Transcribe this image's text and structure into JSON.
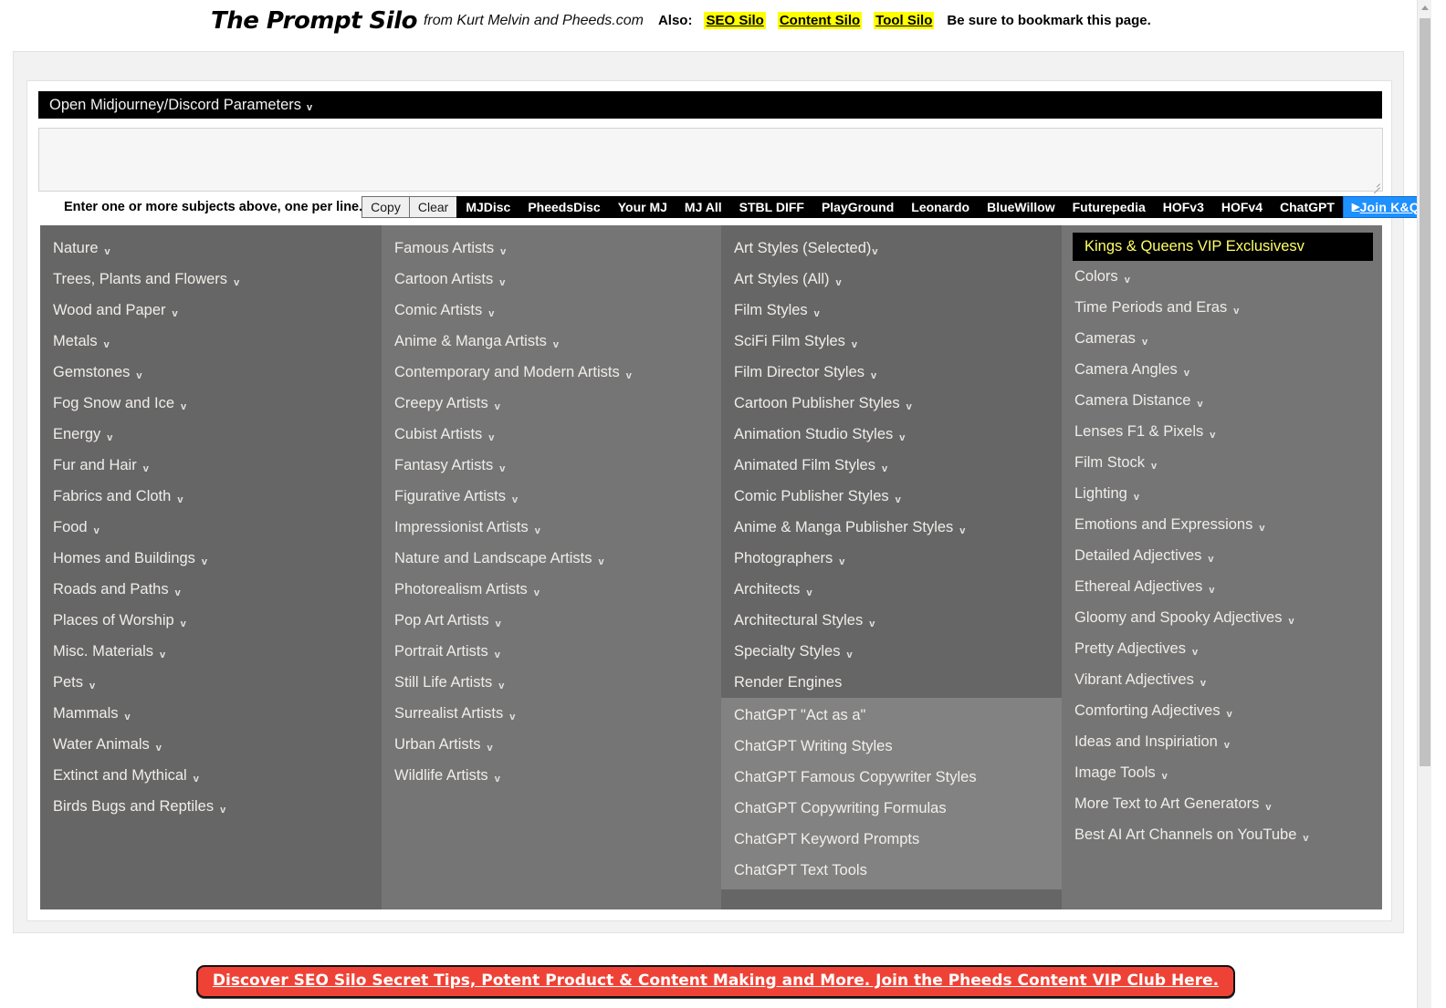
{
  "header": {
    "title": "The Prompt Silo",
    "subtitle": "from Kurt Melvin and Pheeds.com",
    "also_label": "Also:",
    "links": [
      {
        "label": "SEO Silo"
      },
      {
        "label": "Content Silo"
      },
      {
        "label": "Tool Silo"
      }
    ],
    "note": "Be sure to bookmark this page."
  },
  "params_bar": {
    "label": "Open Midjourney/Discord Parameters",
    "chevron": "v"
  },
  "subjects_input": {
    "value": "",
    "placeholder": ""
  },
  "toolbar": {
    "instruction": "Enter one or more subjects above, one per line.",
    "buttons": [
      {
        "label": "Copy",
        "style": "light"
      },
      {
        "label": "Clear",
        "style": "light"
      },
      {
        "label": "MJDisc",
        "style": "dark"
      },
      {
        "label": "PheedsDisc",
        "style": "dark"
      },
      {
        "label": "Your MJ",
        "style": "dark"
      },
      {
        "label": "MJ All",
        "style": "dark"
      },
      {
        "label": "STBL DIFF",
        "style": "dark"
      },
      {
        "label": "PlayGround",
        "style": "dark"
      },
      {
        "label": "Leonardo",
        "style": "dark"
      },
      {
        "label": "BlueWillow",
        "style": "dark"
      },
      {
        "label": "Futurepedia",
        "style": "dark"
      },
      {
        "label": "HOFv3",
        "style": "dark"
      },
      {
        "label": "HOFv4",
        "style": "dark"
      },
      {
        "label": "ChatGPT",
        "style": "dark"
      }
    ],
    "join_button": {
      "label": "Join K&Q + MJ",
      "left_arrow": "▶",
      "right_arrow": "◀"
    }
  },
  "columns": [
    {
      "id": "subjects",
      "items": [
        {
          "label": "Nature",
          "chevron": "v"
        },
        {
          "label": "Trees, Plants and Flowers",
          "chevron": "v"
        },
        {
          "label": "Wood and Paper",
          "chevron": "v"
        },
        {
          "label": "Metals",
          "chevron": "v"
        },
        {
          "label": "Gemstones",
          "chevron": "v"
        },
        {
          "label": "Fog Snow and Ice",
          "chevron": "v"
        },
        {
          "label": "Energy",
          "chevron": "v"
        },
        {
          "label": "Fur and Hair",
          "chevron": "v"
        },
        {
          "label": "Fabrics and Cloth",
          "chevron": "v"
        },
        {
          "label": "Food",
          "chevron": "v"
        },
        {
          "label": "Homes and Buildings",
          "chevron": "v"
        },
        {
          "label": "Roads and Paths",
          "chevron": "v"
        },
        {
          "label": "Places of Worship",
          "chevron": "v"
        },
        {
          "label": "Misc. Materials",
          "chevron": "v"
        },
        {
          "label": "Pets",
          "chevron": "v"
        },
        {
          "label": "Mammals",
          "chevron": "v"
        },
        {
          "label": "Water Animals",
          "chevron": "v"
        },
        {
          "label": "Extinct and Mythical",
          "chevron": "v"
        },
        {
          "label": "Birds Bugs and Reptiles",
          "chevron": "v"
        }
      ]
    },
    {
      "id": "artists",
      "items": [
        {
          "label": "Famous Artists",
          "chevron": "v"
        },
        {
          "label": "Cartoon Artists",
          "chevron": "v"
        },
        {
          "label": "Comic Artists",
          "chevron": "v"
        },
        {
          "label": "Anime & Manga Artists",
          "chevron": "v"
        },
        {
          "label": "Contemporary and Modern Artists",
          "chevron": "v"
        },
        {
          "label": "Creepy Artists",
          "chevron": "v"
        },
        {
          "label": "Cubist Artists",
          "chevron": "v"
        },
        {
          "label": "Fantasy Artists",
          "chevron": "v"
        },
        {
          "label": "Figurative Artists",
          "chevron": "v"
        },
        {
          "label": "Impressionist Artists",
          "chevron": "v"
        },
        {
          "label": "Nature and Landscape Artists",
          "chevron": "v"
        },
        {
          "label": "Photorealism Artists",
          "chevron": "v"
        },
        {
          "label": "Pop Art Artists",
          "chevron": "v"
        },
        {
          "label": "Portrait Artists",
          "chevron": "v"
        },
        {
          "label": "Still Life Artists",
          "chevron": "v"
        },
        {
          "label": "Surrealist Artists",
          "chevron": "v"
        },
        {
          "label": "Urban Artists",
          "chevron": "v"
        },
        {
          "label": "Wildlife Artists",
          "chevron": "v"
        }
      ]
    },
    {
      "id": "styles",
      "items": [
        {
          "label": "Art Styles (Selected)",
          "chevron": "v",
          "tight": true
        },
        {
          "label": "Art Styles (All)",
          "chevron": "v"
        },
        {
          "label": "Film Styles",
          "chevron": "v"
        },
        {
          "label": "SciFi Film Styles",
          "chevron": "v"
        },
        {
          "label": "Film Director Styles",
          "chevron": "v"
        },
        {
          "label": "Cartoon Publisher Styles",
          "chevron": "v"
        },
        {
          "label": "Animation Studio Styles",
          "chevron": "v"
        },
        {
          "label": "Animated Film Styles",
          "chevron": "v"
        },
        {
          "label": "Comic Publisher Styles",
          "chevron": "v"
        },
        {
          "label": "Anime & Manga Publisher Styles",
          "chevron": "v"
        },
        {
          "label": "Photographers",
          "chevron": "v"
        },
        {
          "label": "Architects",
          "chevron": "v"
        },
        {
          "label": "Architectural Styles",
          "chevron": "v"
        },
        {
          "label": "Specialty Styles",
          "chevron": "v"
        },
        {
          "label": "Render Engines",
          "chevron": ""
        }
      ],
      "sub_block": [
        {
          "label": "ChatGPT \"Act as a\"",
          "chevron": ""
        },
        {
          "label": "ChatGPT Writing Styles",
          "chevron": ""
        },
        {
          "label": "ChatGPT Famous Copywriter Styles",
          "chevron": ""
        },
        {
          "label": "ChatGPT Copywriting Formulas",
          "chevron": ""
        },
        {
          "label": "ChatGPT Keyword Prompts",
          "chevron": ""
        },
        {
          "label": "ChatGPT Text Tools",
          "chevron": ""
        }
      ]
    },
    {
      "id": "modifiers",
      "banner": {
        "label": "Kings & Queens VIP Exclusives",
        "chevron": "v"
      },
      "items": [
        {
          "label": "Colors",
          "chevron": "v"
        },
        {
          "label": "Time Periods and Eras",
          "chevron": "v"
        },
        {
          "label": "Cameras",
          "chevron": "v"
        },
        {
          "label": "Camera Angles",
          "chevron": "v"
        },
        {
          "label": "Camera Distance",
          "chevron": "v"
        },
        {
          "label": "Lenses F1 & Pixels",
          "chevron": "v"
        },
        {
          "label": "Film Stock",
          "chevron": "v"
        },
        {
          "label": "Lighting",
          "chevron": "v"
        },
        {
          "label": "Emotions and Expressions",
          "chevron": "v"
        },
        {
          "label": "Detailed Adjectives",
          "chevron": "v"
        },
        {
          "label": "Ethereal Adjectives",
          "chevron": "v"
        },
        {
          "label": "Gloomy and Spooky Adjectives",
          "chevron": "v"
        },
        {
          "label": "Pretty Adjectives",
          "chevron": "v"
        },
        {
          "label": "Vibrant Adjectives",
          "chevron": "v"
        },
        {
          "label": "Comforting Adjectives",
          "chevron": "v"
        },
        {
          "label": "Ideas and Inspiriation",
          "chevron": "v"
        },
        {
          "label": "Image Tools",
          "chevron": "v"
        },
        {
          "label": "More Text to Art Generators",
          "chevron": "v"
        },
        {
          "label": "Best AI Art Channels on YouTube",
          "chevron": "v"
        }
      ]
    }
  ],
  "cta": {
    "label": "Discover SEO Silo Secret Tips, Potent Product & Content Making and More. Join the Pheeds Content VIP Club Here."
  },
  "colors": {
    "highlight_yellow": "#ffff00",
    "vip_text": "#ffff66",
    "join_blue": "#1e90ff",
    "cta_red": "#ef4236",
    "col_dark": "#666666",
    "col_light": "#757575"
  }
}
